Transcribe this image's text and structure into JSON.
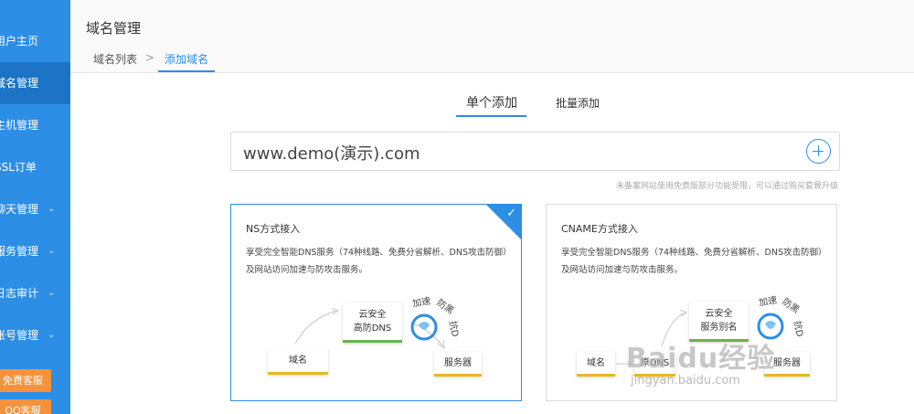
{
  "sidebar": {
    "items": [
      {
        "label": "用户主页",
        "active": false,
        "chevron": false
      },
      {
        "label": "域名管理",
        "active": true,
        "chevron": false
      },
      {
        "label": "主机管理",
        "active": false,
        "chevron": false
      },
      {
        "label": "SSL订单",
        "active": false,
        "chevron": false
      },
      {
        "label": "聊天管理",
        "active": false,
        "chevron": true
      },
      {
        "label": "服务管理",
        "active": false,
        "chevron": true
      },
      {
        "label": "日志审计",
        "active": false,
        "chevron": true
      },
      {
        "label": "账号管理",
        "active": false,
        "chevron": true
      }
    ],
    "buttons": [
      "免费客服",
      "QQ客服"
    ],
    "chevron_glyph": "⌄"
  },
  "header": {
    "title": "域名管理",
    "breadcrumb": {
      "list": "域名列表",
      "separator": ">",
      "current": "添加域名"
    }
  },
  "tabs": {
    "single": "单个添加",
    "batch": "批量添加"
  },
  "domain_input": {
    "value": "www.demo(演示).com"
  },
  "hint": "未备案网站使用免费版部分功能受限，可以通过购买套餐升级",
  "cards": {
    "ns": {
      "title": "NS方式接入",
      "desc": "享受完全智能DNS服务（74种线路、免费分省解析、DNS攻击防御）及网站访问加速与防攻击服务。",
      "nodes": {
        "domain": "域名",
        "center_line1": "云安全",
        "center_line2": "高防DNS",
        "server": "服务器"
      },
      "tags": {
        "speed": "加速",
        "defend": "防黑",
        "attack": "抗D"
      },
      "selected": true
    },
    "cname": {
      "title": "CNAME方式接入",
      "desc": "享受完全智能DNS服务（74种线路、免费分省解析、DNS攻击防御）及网站访问加速与防攻击服务。",
      "nodes": {
        "domain": "域名",
        "dns": "原DNS",
        "center_line1": "云安全",
        "center_line2": "服务别名",
        "server": "服务器"
      },
      "tags": {
        "speed": "加速",
        "defend": "防黑",
        "attack": "抗D"
      },
      "selected": false
    }
  },
  "watermark": {
    "brand": "Baidu经验",
    "url": "jingyan.baidu.com"
  },
  "colors": {
    "primary": "#2d8ee6",
    "sidebar_active": "#1d74c6",
    "orange": "#f5923b",
    "yellow": "#e8b91d",
    "green": "#6ab34a"
  }
}
